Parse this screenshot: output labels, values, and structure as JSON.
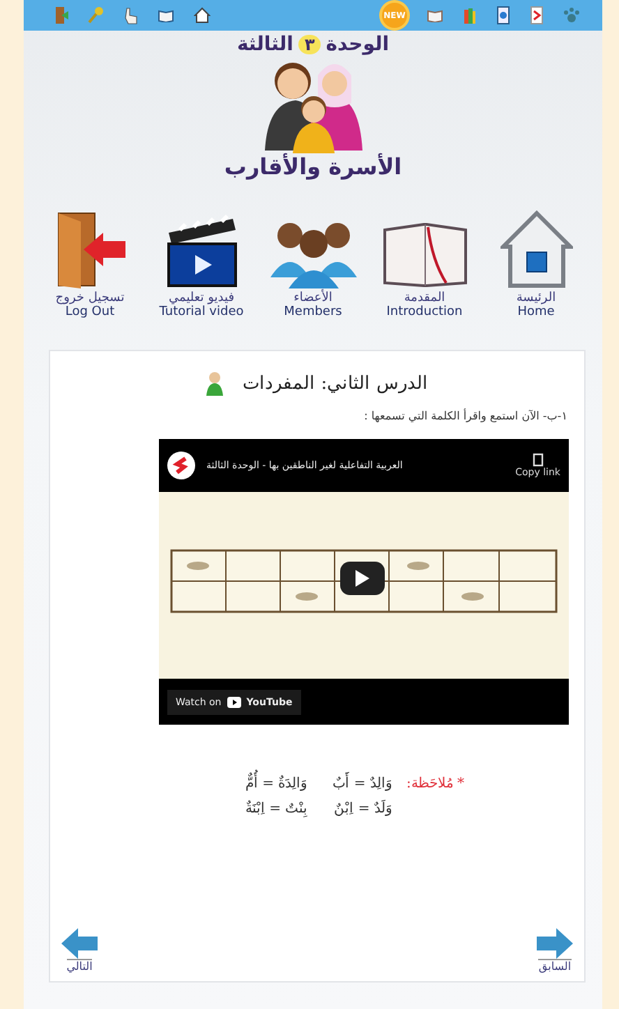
{
  "top_bar": {
    "badge": "NEW"
  },
  "header": {
    "unit_label": "الوحدة",
    "unit_number": "٣",
    "unit_ordinal": "الثالثة",
    "unit_name": "الأسرة والأقارب"
  },
  "nav": [
    {
      "kind": "home",
      "label_ar": "الرئيسة",
      "label_en": "Home"
    },
    {
      "kind": "introduction",
      "label_ar": "المقدمة",
      "label_en": "Introduction"
    },
    {
      "kind": "members",
      "label_ar": "الأعضاء",
      "label_en": "Members"
    },
    {
      "kind": "video",
      "label_ar": "فيديو تعليمي",
      "label_en": "Tutorial video"
    },
    {
      "kind": "logout",
      "label_ar": "تسجيل خروج",
      "label_en": "Log Out"
    }
  ],
  "lesson": {
    "title": "الدرس الثاني: المفردات",
    "instruction": "١-ب- الآن استمع واقرأ الكلمة التي تسمعها :"
  },
  "video": {
    "title": "العربية التفاعلية لغير الناطقين بها - الوحدة الثالثة",
    "copy_link": "Copy link",
    "watch_on": "Watch on",
    "brand": "YouTube"
  },
  "note": {
    "label": "* مُلاحَظة:",
    "items": [
      "وَالِدٌ = أَبٌ",
      "وَالِدَةٌ = أُمٌّ",
      "وَلَدٌ = اِبْنٌ",
      "بِنْتٌ = اِبْنَةٌ"
    ]
  },
  "pager": {
    "next": "التالي",
    "previous": "السابق"
  }
}
